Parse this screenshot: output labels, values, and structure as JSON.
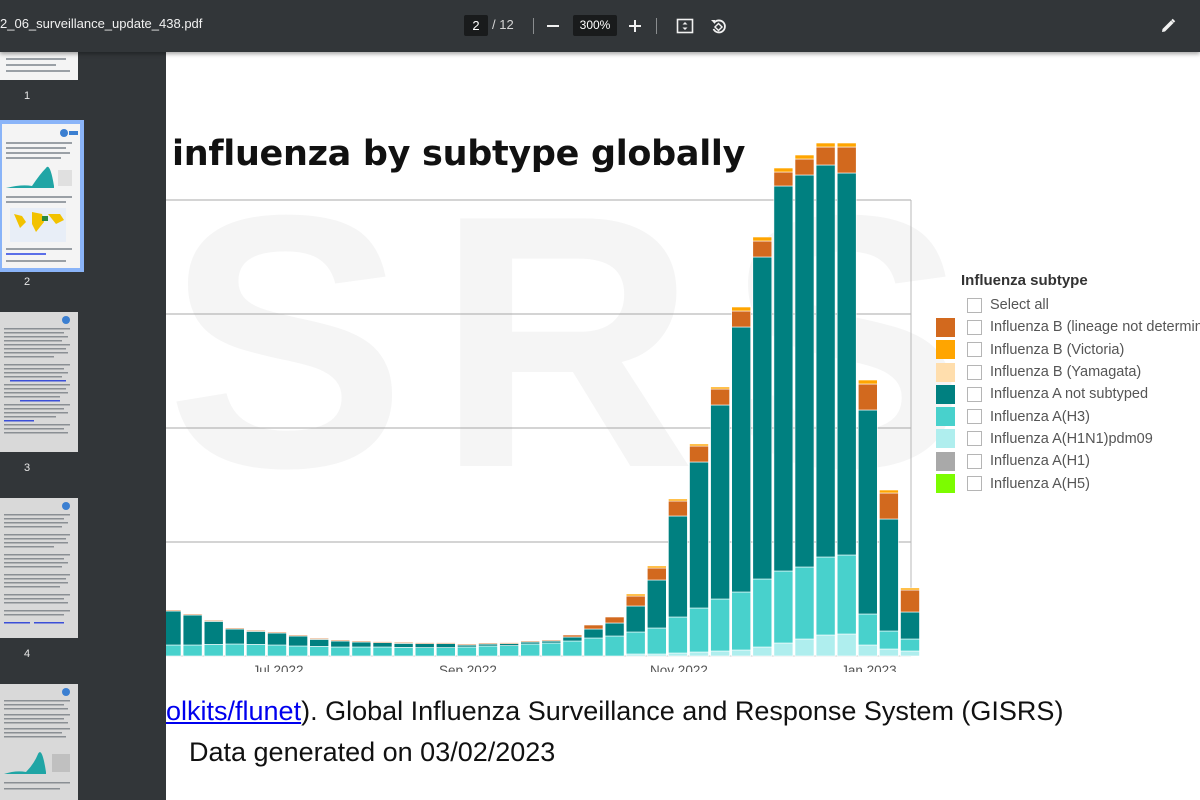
{
  "toolbar": {
    "file_name": "2_06_surveillance_update_438.pdf",
    "current_page": "2",
    "page_total": "/ 12",
    "zoom": "300%"
  },
  "sidebar": {
    "thumbnails": [
      {
        "number": "1"
      },
      {
        "number": "2"
      },
      {
        "number": "3"
      },
      {
        "number": "4"
      }
    ]
  },
  "page": {
    "heading": "influenza by subtype globally",
    "watermark": "SRS",
    "footer_link": "olkits/flunet",
    "footer_rest": "). Global Influenza Surveillance and Response System (GISRS)",
    "footer_line2": "Data generated on 03/02/2023"
  },
  "legend": {
    "title": "Influenza subtype",
    "select_all": "Select all",
    "items": [
      {
        "label": "Influenza B (lineage not determined)",
        "color": "#d2691e"
      },
      {
        "label": "Influenza B (Victoria)",
        "color": "#ffa500"
      },
      {
        "label": "Influenza B (Yamagata)",
        "color": "#ffdead"
      },
      {
        "label": "Influenza A not subtyped",
        "color": "#008080"
      },
      {
        "label": "Influenza A(H3)",
        "color": "#48d1cc"
      },
      {
        "label": "Influenza A(H1N1)pdm09",
        "color": "#afeeee"
      },
      {
        "label": "Influenza A(H1)",
        "color": "#a9a9a9"
      },
      {
        "label": "Influenza A(H5)",
        "color": "#7cfc00"
      }
    ]
  },
  "chart_data": {
    "type": "bar",
    "stacked": true,
    "x_tick_labels": [
      "Jul 2022",
      "Sep 2022",
      "Nov 2022",
      "Jan 2023"
    ],
    "x": [
      1,
      2,
      3,
      4,
      5,
      6,
      7,
      8,
      9,
      10,
      11,
      12,
      13,
      14,
      15,
      16,
      17,
      18,
      19,
      20,
      21,
      22,
      23,
      24,
      25,
      26,
      27,
      28,
      29,
      30,
      31,
      32,
      33,
      34,
      35,
      36
    ],
    "series": [
      {
        "name": "Influenza A(H1N1)pdm09",
        "color": "#afeeee",
        "values": [
          0,
          0,
          0,
          0,
          0,
          0,
          0,
          0,
          0,
          0,
          0,
          0,
          0,
          0,
          0,
          0,
          0,
          0,
          0,
          0,
          0,
          0,
          0.1,
          0.1,
          0.15,
          0.2,
          0.25,
          0.3,
          0.45,
          0.65,
          0.85,
          1.05,
          1.1,
          0.55,
          0.35,
          0.25
        ]
      },
      {
        "name": "Influenza A(H3)",
        "color": "#48d1cc",
        "values": [
          0.55,
          0.55,
          0.58,
          0.6,
          0.58,
          0.55,
          0.5,
          0.48,
          0.45,
          0.45,
          0.45,
          0.43,
          0.42,
          0.42,
          0.45,
          0.5,
          0.52,
          0.6,
          0.65,
          0.75,
          0.9,
          1.0,
          1.1,
          1.3,
          1.8,
          2.2,
          2.6,
          2.9,
          3.4,
          3.6,
          3.6,
          3.9,
          3.95,
          1.55,
          0.9,
          0.6
        ]
      },
      {
        "name": "Influenza A not subtyped",
        "color": "#008080",
        "values": [
          1.7,
          1.5,
          1.15,
          0.75,
          0.65,
          0.6,
          0.5,
          0.35,
          0.3,
          0.25,
          0.22,
          0.2,
          0.2,
          0.2,
          0.1,
          0.1,
          0.1,
          0.1,
          0.1,
          0.2,
          0.45,
          0.65,
          1.3,
          2.4,
          5.05,
          7.3,
          9.7,
          13.25,
          16.1,
          19.25,
          19.6,
          19.6,
          19.1,
          10.2,
          5.6,
          1.35
        ]
      },
      {
        "name": "Influenza B (lineage not determined)",
        "color": "#d2691e",
        "values": [
          0.05,
          0.05,
          0.05,
          0.05,
          0.05,
          0.05,
          0.05,
          0.05,
          0.05,
          0.05,
          0.05,
          0.05,
          0.05,
          0.05,
          0.05,
          0.05,
          0.05,
          0.05,
          0.05,
          0.1,
          0.2,
          0.3,
          0.5,
          0.6,
          0.75,
          0.8,
          0.8,
          0.8,
          0.8,
          0.7,
          0.8,
          0.9,
          1.3,
          1.3,
          1.3,
          1.1
        ]
      },
      {
        "name": "Influenza B (Victoria)",
        "color": "#ffa500",
        "values": [
          0,
          0,
          0,
          0,
          0,
          0,
          0,
          0,
          0,
          0,
          0,
          0,
          0,
          0,
          0,
          0,
          0,
          0,
          0,
          0,
          0,
          0,
          0.1,
          0.1,
          0.1,
          0.1,
          0.1,
          0.2,
          0.2,
          0.2,
          0.2,
          0.2,
          0.2,
          0.2,
          0.15,
          0.1
        ]
      }
    ],
    "legend_position": "right",
    "grid": true
  }
}
